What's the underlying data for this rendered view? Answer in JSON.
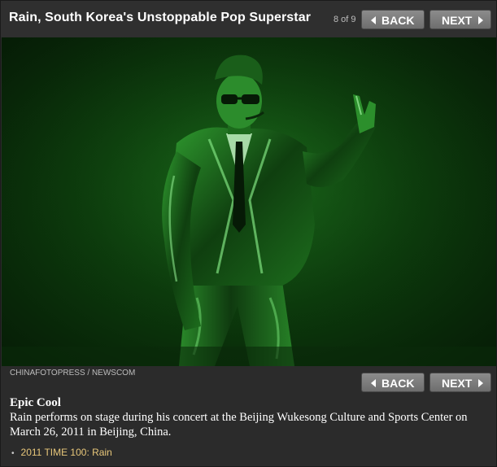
{
  "header": {
    "title": "Rain, South Korea's Unstoppable Pop Superstar",
    "counter": "8 of 9"
  },
  "nav": {
    "back_label": "BACK",
    "next_label": "NEXT"
  },
  "photo": {
    "credit": "CHINAFOTOPRESS / NEWSCOM"
  },
  "caption": {
    "title": "Epic Cool",
    "body": "Rain performs on stage during his concert at the Beijing Wukesong Culture and Sports Center on March 26, 2011 in Beijing, China."
  },
  "related": [
    {
      "label": "2011 TIME 100: Rain"
    }
  ],
  "colors": {
    "background": "#2b2b2b",
    "button": "#7d7d7d",
    "link": "#e8c77a",
    "photo_tint": "#165a16"
  },
  "icons": {
    "back": "arrow-left-icon",
    "next": "arrow-right-icon"
  }
}
